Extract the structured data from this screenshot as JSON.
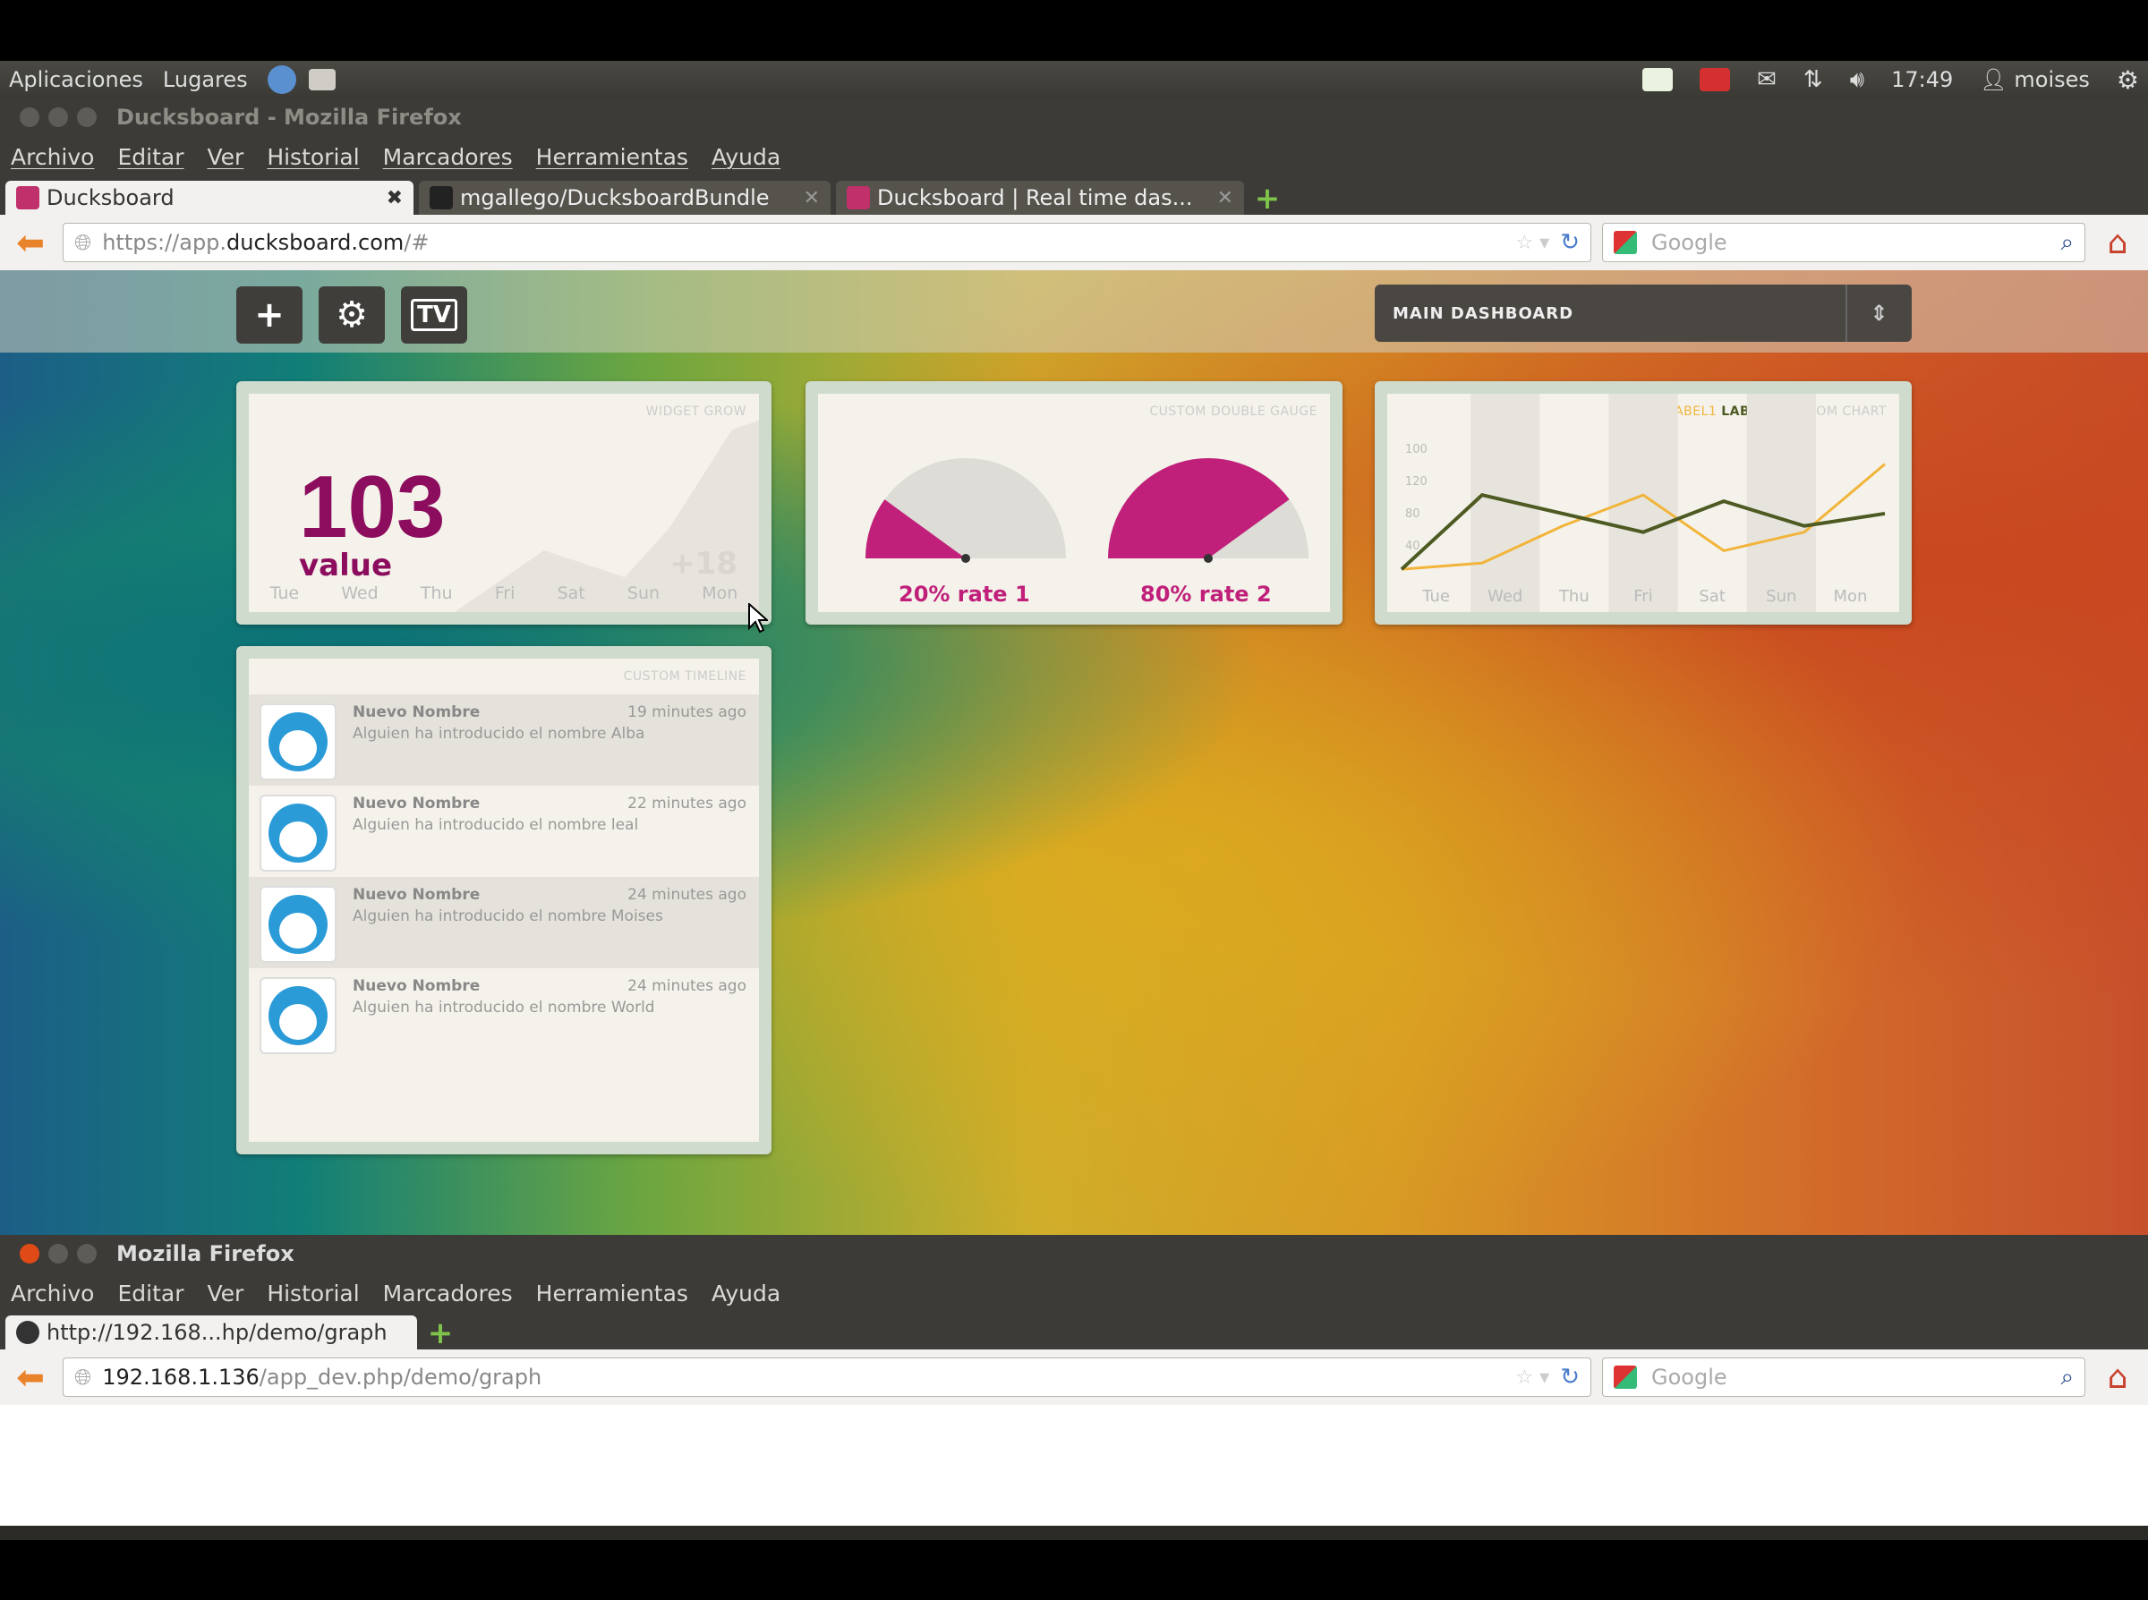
{
  "desktop": {
    "menus": [
      "Aplicaciones",
      "Lugares"
    ],
    "clock": "17:49",
    "user": "moises"
  },
  "win1": {
    "title": "Ducksboard - Mozilla Firefox",
    "menu": [
      "Archivo",
      "Editar",
      "Ver",
      "Historial",
      "Marcadores",
      "Herramientas",
      "Ayuda"
    ],
    "tabs": [
      {
        "label": "Ducksboard",
        "close": "✖"
      },
      {
        "label": "mgallego/DucksboardBundle",
        "close": "✕"
      },
      {
        "label": "Ducksboard | Real time das...",
        "close": "✕"
      }
    ],
    "url_prefix": "https://app.",
    "url_domain": "ducksboard.com",
    "url_suffix": "/#",
    "search_placeholder": "Google"
  },
  "dashboard": {
    "selector": "MAIN DASHBOARD",
    "tv_label": "TV",
    "counter": {
      "title": "WIDGET GROW",
      "value": "103",
      "label": "value",
      "delta": "+18",
      "days": [
        "Tue",
        "Wed",
        "Thu",
        "Fri",
        "Sat",
        "Sun",
        "Mon"
      ]
    },
    "gauge": {
      "title": "CUSTOM DOUBLE GAUGE",
      "label1": "20% rate 1",
      "label2": "80% rate 2",
      "value1": 0.2,
      "value2": 0.8,
      "color": "#c01f7a"
    },
    "linechart": {
      "legend1": "LABEL1",
      "legend2": "LABEL2",
      "title": "CUSTOM CHART",
      "days": [
        "Tue",
        "Wed",
        "Thu",
        "Fri",
        "Sat",
        "Sun",
        "Mon"
      ],
      "yticks": [
        "100",
        "120",
        "80",
        "40"
      ]
    },
    "timeline": {
      "title": "CUSTOM TIMELINE",
      "items": [
        {
          "name": "Nuevo Nombre",
          "text": "Alguien ha introducido el nombre Alba",
          "time": "19 minutes ago"
        },
        {
          "name": "Nuevo Nombre",
          "text": "Alguien ha introducido el nombre leal",
          "time": "22 minutes ago"
        },
        {
          "name": "Nuevo Nombre",
          "text": "Alguien ha introducido el nombre Moises",
          "time": "24 minutes ago"
        },
        {
          "name": "Nuevo Nombre",
          "text": "Alguien ha introducido el nombre World",
          "time": "24 minutes ago"
        }
      ]
    }
  },
  "chart_data": {
    "type": "line",
    "categories": [
      "Tue",
      "Wed",
      "Thu",
      "Fri",
      "Sat",
      "Sun",
      "Mon"
    ],
    "series": [
      {
        "name": "LABEL1",
        "values": [
          10,
          15,
          45,
          70,
          25,
          40,
          95
        ]
      },
      {
        "name": "LABEL2",
        "values": [
          10,
          70,
          55,
          40,
          65,
          45,
          55
        ]
      }
    ],
    "ylim": [
      0,
      120
    ],
    "title": "CUSTOM CHART"
  },
  "win2": {
    "title": "Mozilla Firefox",
    "menu": [
      "Archivo",
      "Editar",
      "Ver",
      "Historial",
      "Marcadores",
      "Herramientas",
      "Ayuda"
    ],
    "tab": "http://192.168...hp/demo/graph",
    "url_host": "192.168.1.136",
    "url_path": "/app_dev.php/demo/graph",
    "search_placeholder": "Google"
  }
}
